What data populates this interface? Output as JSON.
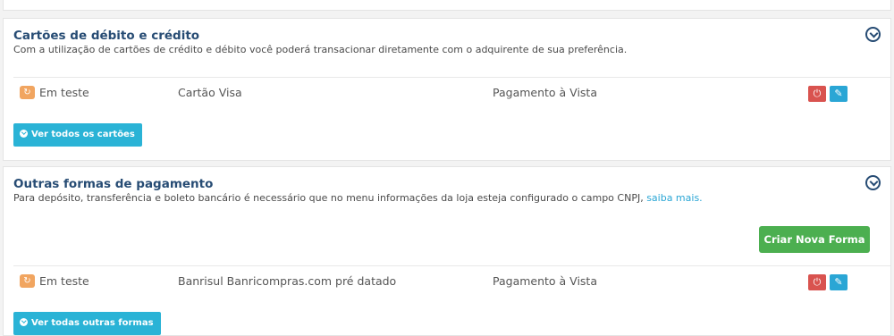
{
  "cards_section": {
    "title": "Cartões de débito e crédito",
    "description": "Com a utilização de cartões de crédito e débito você poderá transacionar diretamente com o adquirente de sua preferência.",
    "rows": [
      {
        "status": "Em teste",
        "name": "Cartão Visa",
        "payment_type": "Pagamento à Vista"
      }
    ],
    "view_all_label": "Ver todos os cartões"
  },
  "other_section": {
    "title": "Outras formas de pagamento",
    "description": "Para depósito, transferência e boleto bancário é necessário que no menu informações da loja esteja configurado o campo CNPJ,",
    "link_text": "saiba mais.",
    "create_label": "Criar Nova Forma",
    "rows": [
      {
        "status": "Em teste",
        "name": "Banrisul Banricompras.com pré datado",
        "payment_type": "Pagamento à Vista"
      }
    ],
    "view_all_label": "Ver todas outras formas"
  },
  "colors": {
    "title": "#274c74",
    "status_icon": "#f1a560",
    "power_button": "#d9534f",
    "edit_button": "#2aa6d5",
    "create_button": "#4caf50",
    "link": "#2aa6d5"
  },
  "icons": {
    "status": "refresh-icon",
    "toggle": "chevron-circle-down-icon",
    "power": "power-icon",
    "edit": "pencil-icon"
  }
}
